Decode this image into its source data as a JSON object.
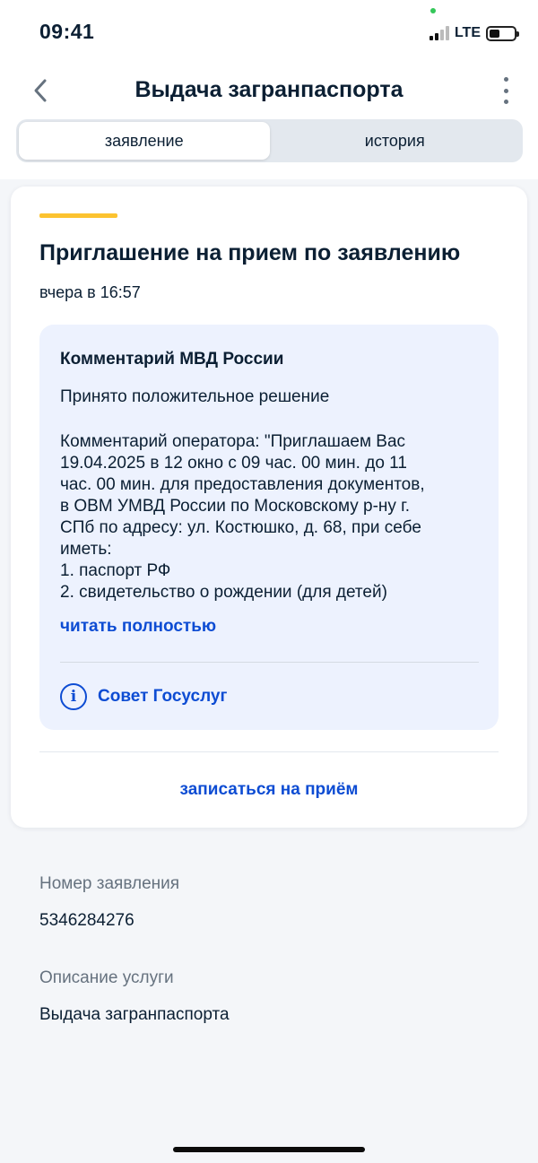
{
  "status_bar": {
    "time": "09:41",
    "network": "LTE"
  },
  "header": {
    "title": "Выдача загранпаспорта",
    "back_icon": "chevron-left-icon",
    "more_icon": "more-vertical-icon"
  },
  "tabs": [
    {
      "label": "заявление",
      "active": true
    },
    {
      "label": "история",
      "active": false
    }
  ],
  "event": {
    "title": "Приглашение на прием по заявлению",
    "time": "вчера в 16:57",
    "accent_color": "#fcc330"
  },
  "comment": {
    "title": "Комментарий МВД России",
    "status": "Принято положительное решение",
    "text": "Комментарий оператора: \"Приглашаем Вас\n19.04.2025 в 12 окно с 09 час. 00 мин. до 11\nчас. 00 мин. для предоставления документов,\nв ОВМ УМВД России по Московскому р-ну г.\nСПб по адресу: ул. Костюшко, д. 68, при себе\nиметь:\n1. паспорт РФ\n2. свидетельство о рождении (для детей)",
    "read_more": "читать полностью",
    "advice_label": "Совет Госуслуг",
    "advice_icon": "info-icon"
  },
  "actions": {
    "signup": "записаться на приём"
  },
  "details": {
    "number_label": "Номер заявления",
    "number_value": "5346284276",
    "service_label": "Описание услуги",
    "service_value": "Выдача загранпаспорта"
  },
  "colors": {
    "link": "#0d4cd3",
    "background": "#f4f6f9",
    "comment_bg": "#edf2fe"
  }
}
